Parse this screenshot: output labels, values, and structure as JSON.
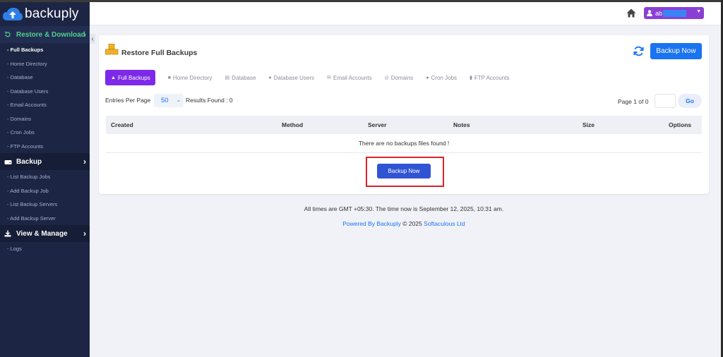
{
  "app": {
    "name": "backuply"
  },
  "sidebar": {
    "sections": [
      {
        "label": "Restore & Download",
        "items": [
          "- Full Backups",
          "- Home Directory",
          "- Database",
          "- Database Users",
          "- Email Accounts",
          "- Domains",
          "- Cron Jobs",
          "- FTP Accounts"
        ]
      },
      {
        "label": "Backup",
        "items": [
          "- List Backup Jobs",
          "- Add Backup Job",
          "- List Backup Servers",
          "- Add Backup Server"
        ]
      },
      {
        "label": "View & Manage",
        "items": [
          "- Logs"
        ]
      }
    ]
  },
  "topbar": {
    "user": "ab"
  },
  "card": {
    "title": "Restore Full Backups",
    "backup_now": "Backup Now",
    "tabs": [
      "Full Backups",
      "Home Directory",
      "Database",
      "Database Users",
      "Email Accounts",
      "Domains",
      "Cron Jobs",
      "FTP Accounts"
    ],
    "entries_label": "Entries Per Page",
    "entries_value": "50",
    "results": "Results Found : 0",
    "page_info": "Page 1 of 0",
    "go": "Go",
    "columns": [
      "Created",
      "Method",
      "Server",
      "Notes",
      "Size",
      "Options"
    ],
    "empty_message": "There are no backups files found !",
    "center_button": "Backup Now"
  },
  "time_note": "All times are GMT +05:30. The time now is September 12, 2025, 10:31 am.",
  "footer": {
    "powered": "Powered By Backuply",
    "copyright": " © 2025 ",
    "company": "Softaculous Ltd"
  },
  "colors": {
    "sidebar_bg": "#1c2544",
    "accent_green": "#4fd08a",
    "primary_blue": "#1a73f0",
    "tab_purple": "#7d2ae8",
    "highlight_red": "#d9252a"
  }
}
